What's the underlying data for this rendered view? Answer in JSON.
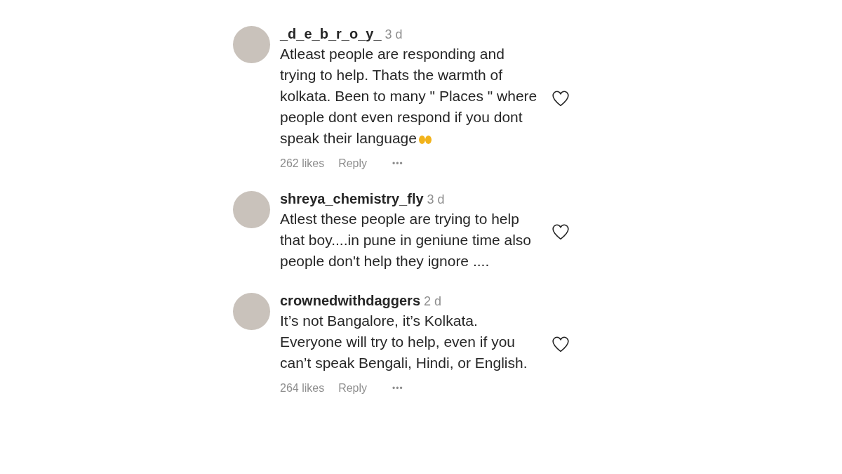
{
  "comments": [
    {
      "username": "_d_e_b_r_o_y_",
      "time": "3 d",
      "text": "Atleast people are responding and trying to help. Thats the warmth of kolkata. Been to many \" Places \" where people dont even respond if you dont speak their language",
      "emoji": true,
      "liked": false,
      "likes": "262 likes",
      "reply": "Reply",
      "more": "•••"
    },
    {
      "username": "shreya_chemistry_fly",
      "time": "3 d",
      "text": "Atlest these people are trying to help that boy....in pune in geniune time also people don't help they ignore ....",
      "emoji": false,
      "liked": false
    },
    {
      "username": "crownedwithdaggers",
      "time": "2 d",
      "text": "It’s not Bangalore, it’s Kolkata. Everyone will try to help, even if you can’t speak Bengali, Hindi, or English.",
      "emoji": false,
      "liked": false,
      "likes": "264 likes",
      "reply": "Reply",
      "more": "•••"
    }
  ]
}
